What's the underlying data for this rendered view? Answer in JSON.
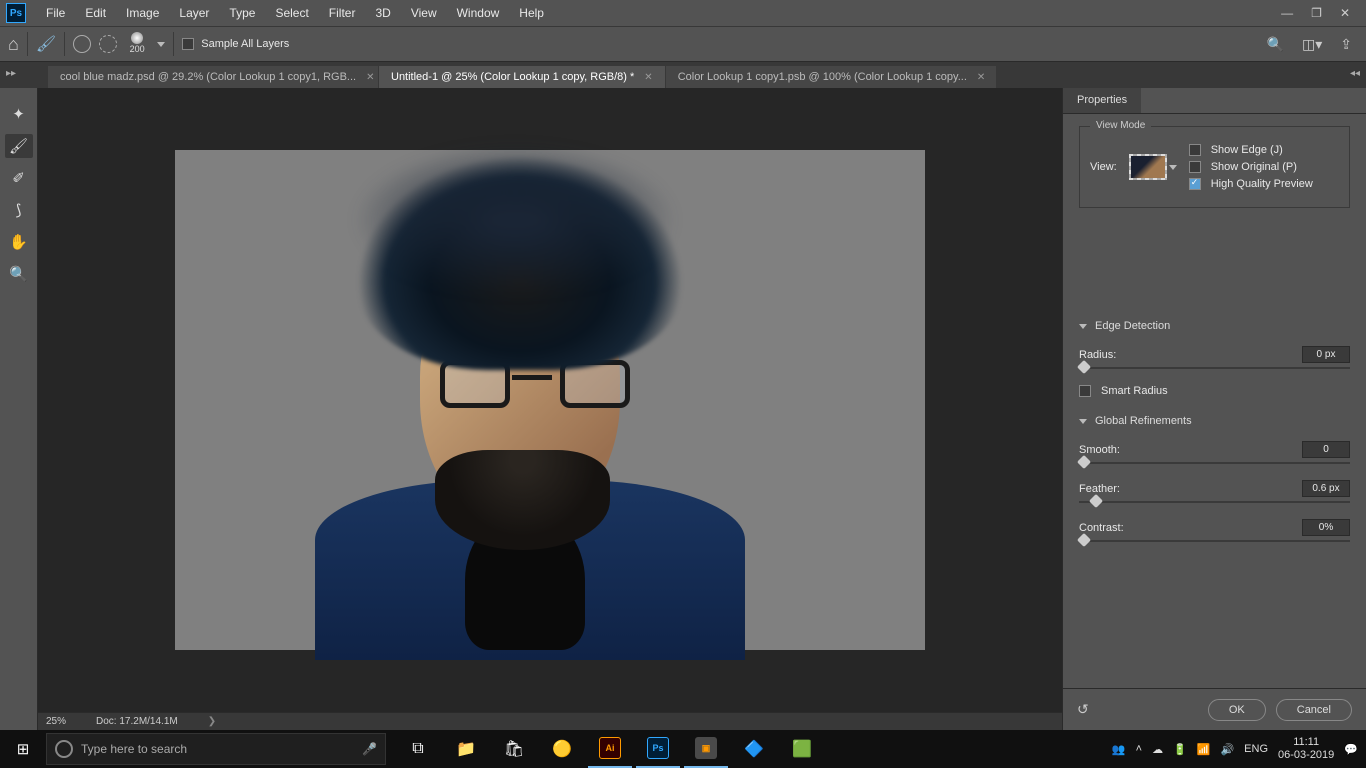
{
  "menu": {
    "items": [
      "File",
      "Edit",
      "Image",
      "Layer",
      "Type",
      "Select",
      "Filter",
      "3D",
      "View",
      "Window",
      "Help"
    ]
  },
  "optionsBar": {
    "brushSize": "200",
    "sampleAllLayers": "Sample All Layers"
  },
  "tabs": [
    {
      "label": "cool blue madz.psd @ 29.2% (Color Lookup 1 copy1, RGB...",
      "active": false
    },
    {
      "label": "Untitled-1 @ 25% (Color Lookup 1 copy, RGB/8) *",
      "active": true
    },
    {
      "label": "Color Lookup 1 copy1.psb @ 100% (Color Lookup 1 copy...",
      "active": false
    }
  ],
  "status": {
    "zoom": "25%",
    "doc": "Doc: 17.2M/14.1M"
  },
  "properties": {
    "tabLabel": "Properties",
    "viewModeLegend": "View Mode",
    "viewLabel": "View:",
    "showEdge": "Show Edge (J)",
    "showOriginal": "Show Original (P)",
    "hqPreview": "High Quality Preview",
    "edgeDetection": "Edge Detection",
    "radiusLabel": "Radius:",
    "radiusValue": "0 px",
    "smartRadius": "Smart Radius",
    "globalRefinements": "Global Refinements",
    "smoothLabel": "Smooth:",
    "smoothValue": "0",
    "featherLabel": "Feather:",
    "featherValue": "0.6 px",
    "contrastLabel": "Contrast:",
    "contrastValue": "0%",
    "okLabel": "OK",
    "cancelLabel": "Cancel"
  },
  "taskbar": {
    "searchPlaceholder": "Type here to search",
    "lang": "ENG",
    "time": "11:11",
    "date": "06-03-2019"
  }
}
